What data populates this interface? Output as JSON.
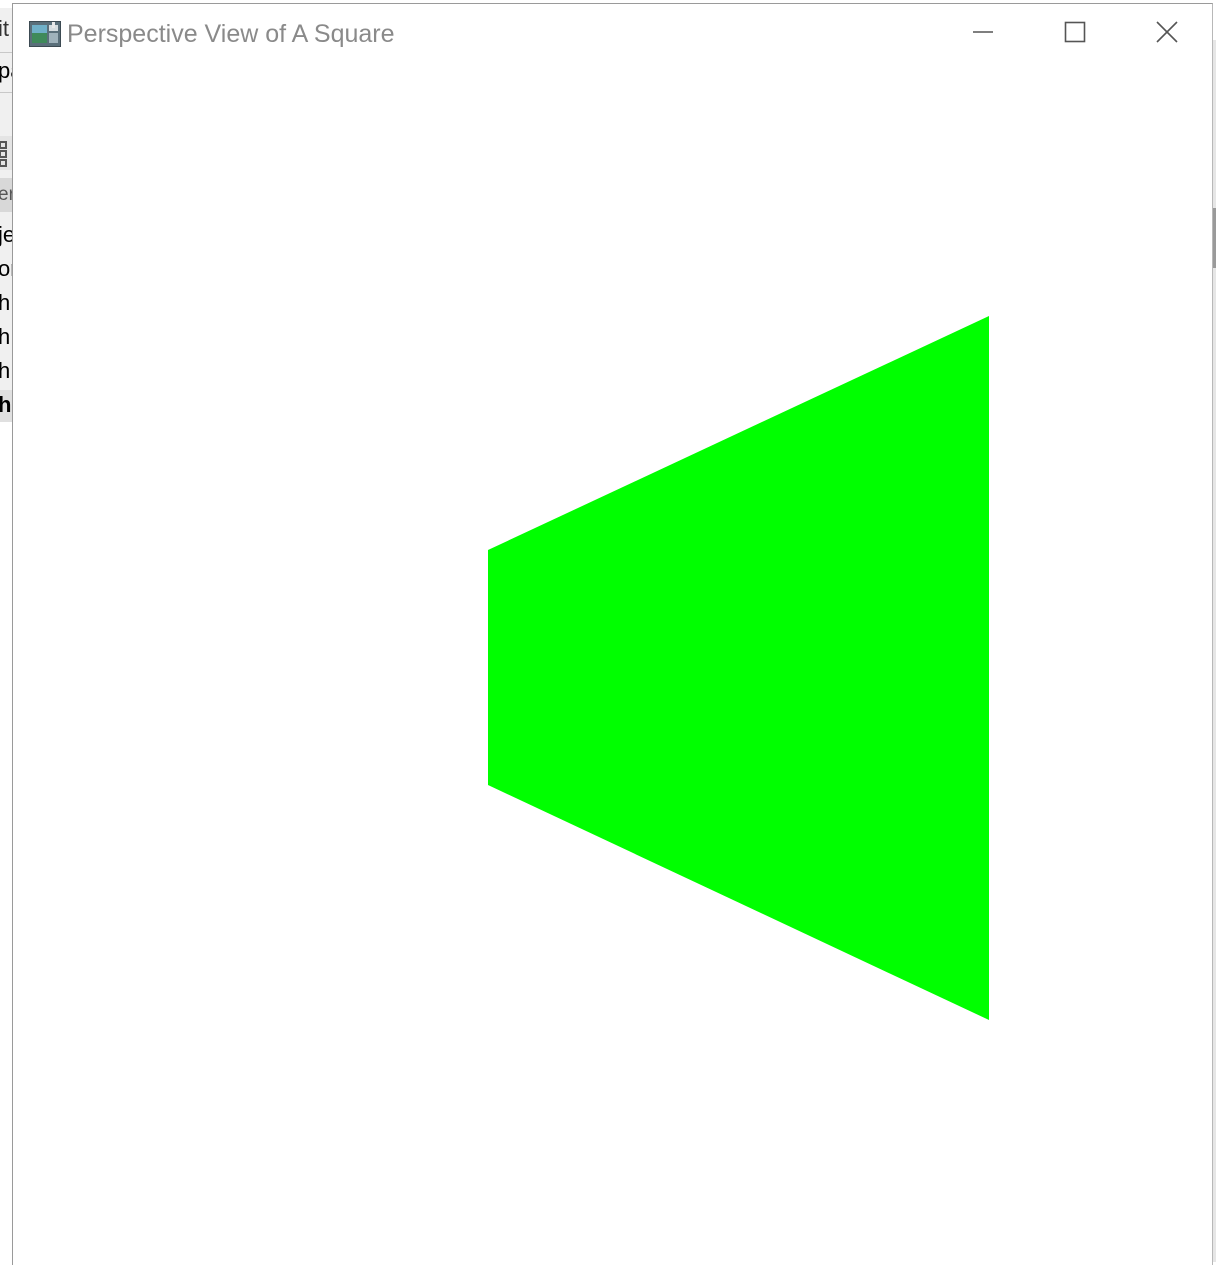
{
  "window": {
    "title": "Perspective View of A Square",
    "app_icon": "opengl-app-icon",
    "controls": {
      "minimize_icon": "minimize-icon",
      "maximize_icon": "maximize-icon",
      "close_icon": "close-icon"
    }
  },
  "scene": {
    "shape": "square (perspective view)",
    "fill_color": "#00ff00",
    "background_color": "#ffffff"
  },
  "background_app": {
    "text_fragments": [
      "it",
      "pa",
      "er",
      "je",
      "or",
      "h",
      "h",
      "h",
      "h"
    ]
  }
}
